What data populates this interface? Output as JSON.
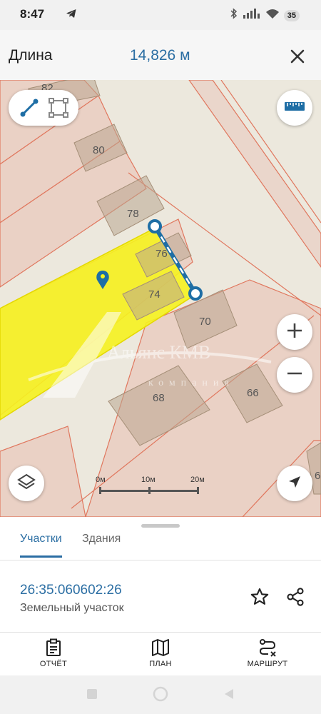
{
  "status_bar": {
    "time": "8:47",
    "battery": "35",
    "icons": [
      "telegram-icon",
      "bluetooth-icon",
      "signal-icon",
      "wifi-icon",
      "battery-icon"
    ]
  },
  "header": {
    "title": "Длина",
    "value": "14,826 м",
    "close_icon": "close-icon"
  },
  "map": {
    "parcel_labels": [
      "82",
      "80",
      "78",
      "76",
      "74",
      "70",
      "68",
      "66",
      "6"
    ],
    "watermark_main": "Альянс КМВ",
    "watermark_sub": "компания",
    "scale": {
      "labels": [
        "0м",
        "10м",
        "20м"
      ]
    },
    "colors": {
      "selected_parcel": "#f6f21f",
      "measure_line": "#1e6ea5",
      "boundary": "#e0775e",
      "building": "#b9a58f"
    }
  },
  "tabs": {
    "parcels": "Участки",
    "buildings": "Здания"
  },
  "parcel": {
    "cadastral_number": "26:35:060602:26",
    "type": "Земельный участок"
  },
  "bottom_nav": {
    "report": "ОТЧЁТ",
    "plan": "ПЛАН",
    "route": "МАРШРУТ"
  },
  "accent_color": "#2b6ea3"
}
